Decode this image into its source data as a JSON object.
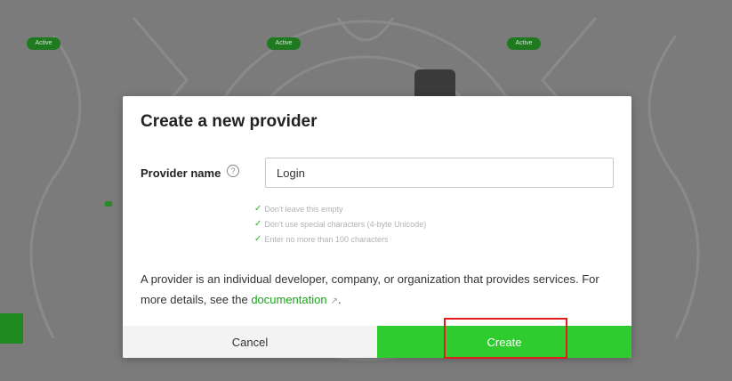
{
  "modal": {
    "title": "Create a new provider",
    "field_label": "Provider name",
    "help_icon": "help-circle-icon",
    "input_value": "Login",
    "rules": [
      "Don't leave this empty",
      "Don't use special characters (4-byte Unicode)",
      "Enter no more than 100 characters"
    ],
    "check_icon": "check-icon",
    "description_text": "A provider is an individual developer, company, or organization that provides services. For more details, see the",
    "doc_link": "documentation",
    "external_icon": "external-link-icon",
    "description_end": ".",
    "cancel_label": "Cancel",
    "create_label": "Create"
  },
  "background": {
    "badge_1": "Active",
    "badge_2": "Active",
    "badge_3": "Active"
  },
  "colors": {
    "primary_green": "#2fcc2f",
    "link_green": "#1aa31a",
    "highlight_red": "#e31b1b",
    "overlay": "#7b7b7b"
  }
}
